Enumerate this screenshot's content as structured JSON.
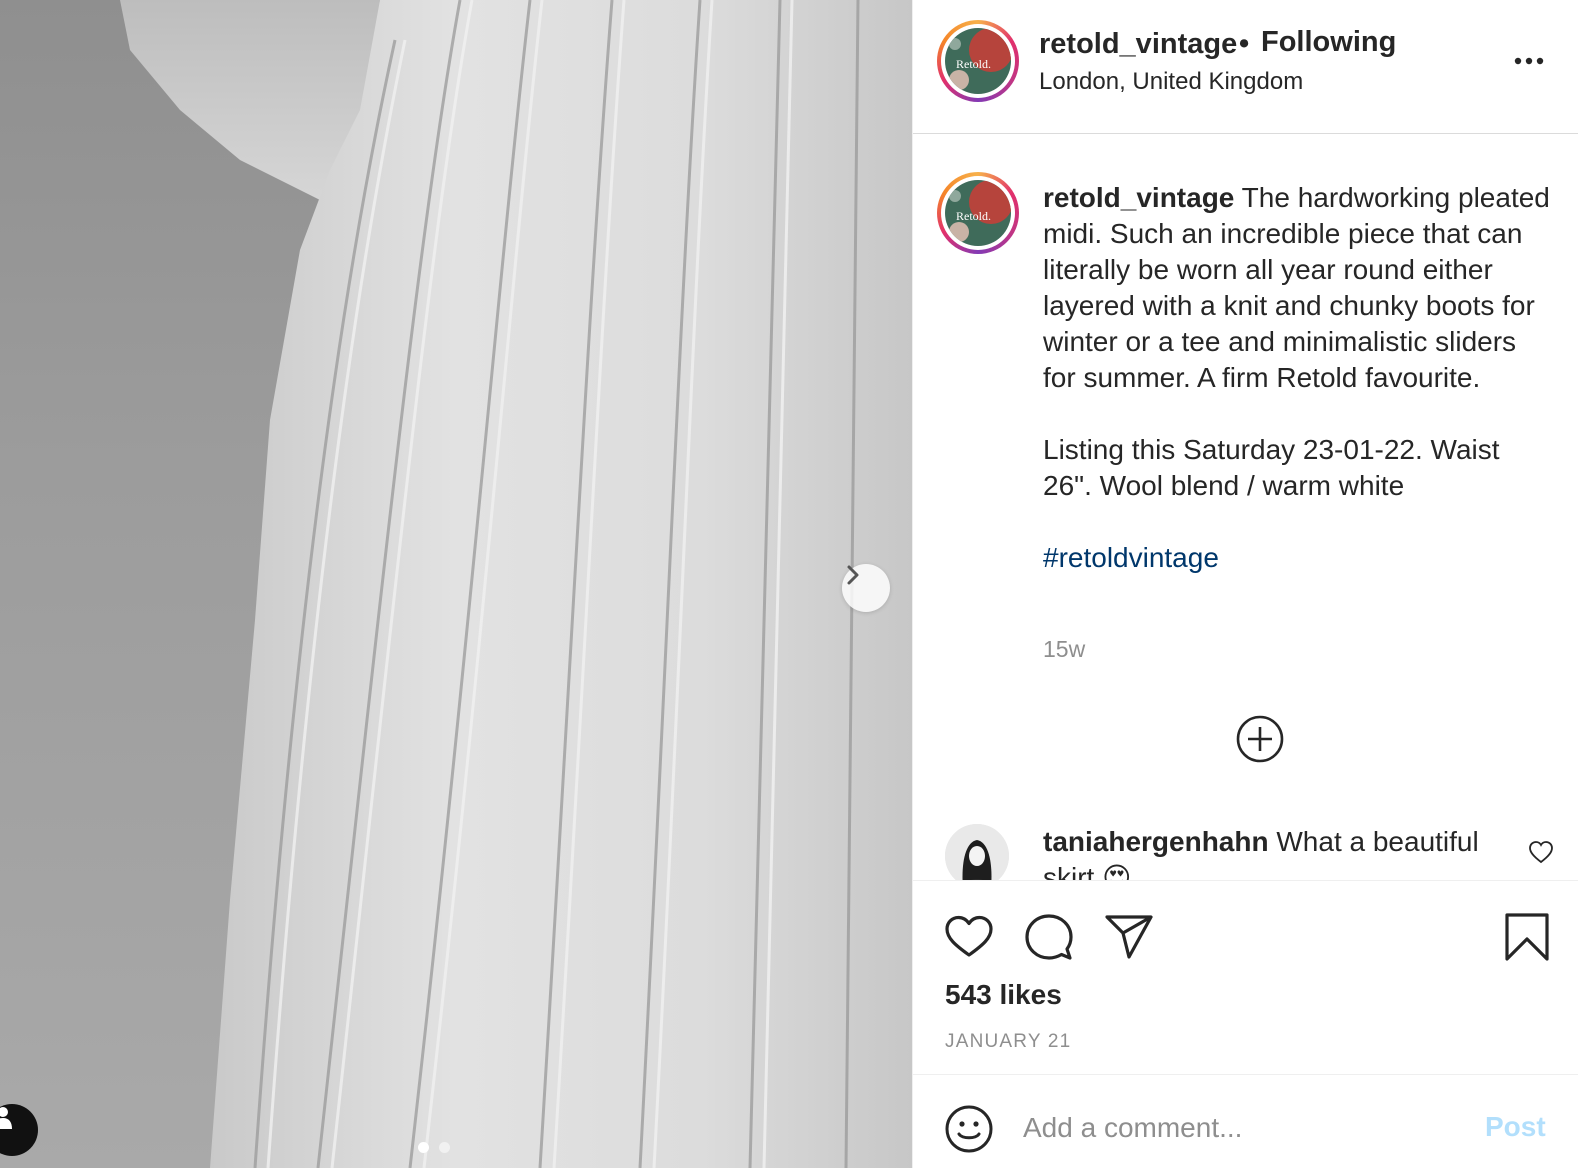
{
  "post": {
    "images_count": 2,
    "current_image": 1,
    "next_icon": "chevron-right-icon",
    "tag_icon": "user-tag-icon"
  },
  "header": {
    "username": "retold_vintage",
    "separator": "•",
    "follow_status": "Following",
    "location": "London, United Kingdom",
    "avatar_text": "Retold."
  },
  "caption": {
    "username": "retold_vintage",
    "paragraph1": "The hardworking pleated midi. Such an incredible piece that can literally be worn all year round either layered with a knit and chunky boots for winter or a tee and minimalistic sliders for summer. A firm Retold favourite.",
    "paragraph2": "Listing this Saturday 23-01-22. Waist 26\". Wool blend / warm white",
    "hashtag": "#retoldvintage",
    "age": "15w"
  },
  "comments": [
    {
      "username": "taniahergenhahn",
      "text": "What a beautiful skirt 😍"
    }
  ],
  "actions": {
    "likes": "543 likes",
    "date": "JANUARY 21"
  },
  "add_comment": {
    "placeholder": "Add a comment...",
    "post_label": "Post"
  },
  "colors": {
    "link": "#00376b",
    "muted": "#8e8e8e",
    "post_disabled": "#b2dffc",
    "avatar_green": "#3f6b5a",
    "avatar_red": "#b6443c"
  }
}
